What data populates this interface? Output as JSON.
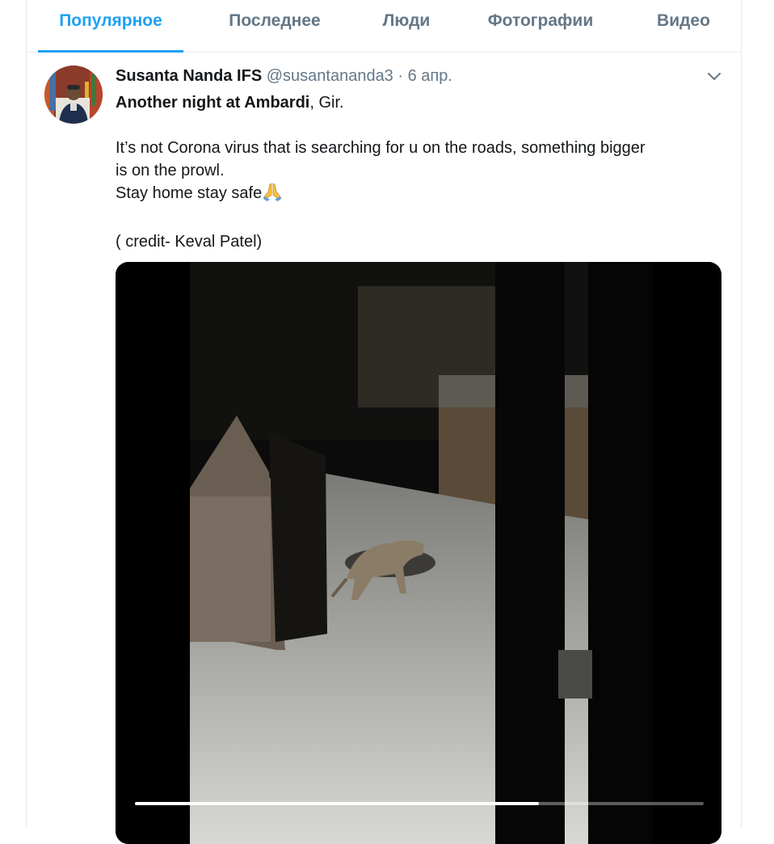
{
  "tabs": [
    {
      "label": "Популярное",
      "active": true
    },
    {
      "label": "Последнее",
      "active": false
    },
    {
      "label": "Люди",
      "active": false
    },
    {
      "label": "Фотографии",
      "active": false
    },
    {
      "label": "Видео",
      "active": false
    }
  ],
  "tweet": {
    "author_name": "Susanta Nanda IFS",
    "handle": "@susantananda3",
    "separator": "·",
    "time": "6 апр.",
    "line1_bold": "Another night at Ambardi",
    "line1_rest": ", Gir.",
    "para2_line1": "It’s not Corona virus that is searching for u on the roads, something bigger",
    "para2_line2": "is on the prowl.",
    "para2_line3": "Stay home stay safe",
    "emoji": "folded-hands-emoji",
    "credit": "( credit- Keval Patel)",
    "menu_icon": "chevron-down-icon"
  },
  "video": {
    "progress": 0.71
  },
  "colors": {
    "accent": "#1da1f2",
    "muted": "#657786",
    "text": "#14171a",
    "border": "#e6ecf0"
  }
}
